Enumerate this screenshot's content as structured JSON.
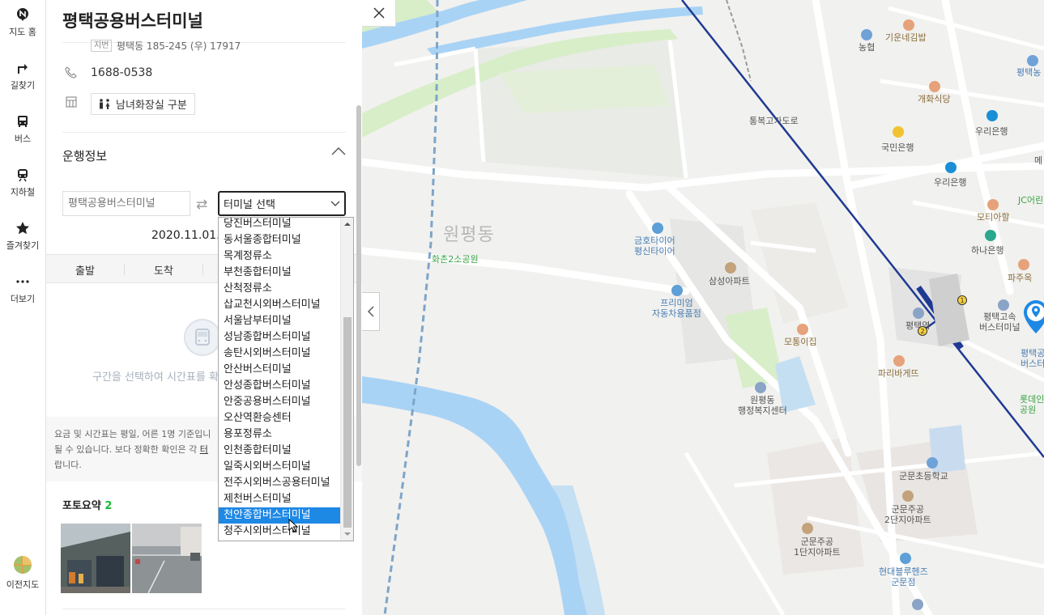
{
  "nav": {
    "items": [
      {
        "label": "지도 홈",
        "icon": "map-home-icon"
      },
      {
        "label": "길찾기",
        "icon": "directions-icon"
      },
      {
        "label": "버스",
        "icon": "bus-icon"
      },
      {
        "label": "지하철",
        "icon": "subway-icon"
      },
      {
        "label": "즐겨찾기",
        "icon": "star-icon"
      },
      {
        "label": "더보기",
        "icon": "more-icon"
      }
    ],
    "prev_map_label": "이전지도"
  },
  "panel": {
    "title": "평택공용버스터미널",
    "address_tag": "지번",
    "address": "평택동 185-245 (우) 17917",
    "phone": "1688-0538",
    "facility": "남녀화장실 구분",
    "section_title": "운행정보",
    "from_placeholder": "평택공용버스터미널",
    "select_label": "터미널 선택",
    "date": "2020.11.01.(",
    "tabs": [
      "출발",
      "도착"
    ],
    "hint": "구간을 선택하여 시간표를 확",
    "notice": {
      "line1": "요금 및 시간표는 평일, 어른 1명 기준입니",
      "line2_pre": "될 수 있습니다. 보다 정확한 확인은 각 ",
      "line2_link": "터",
      "line3": "랍니다."
    },
    "photo_title": "포토요약",
    "photo_count": "2"
  },
  "dropdown": {
    "options": [
      "당진버스터미널",
      "동서울종합터미널",
      "목계정류소",
      "부천종합터미널",
      "산척정류소",
      "삽교천시외버스터미널",
      "서울남부터미널",
      "성남종합버스터미널",
      "송탄시외버스터미널",
      "안산버스터미널",
      "안성종합버스터미널",
      "안중공용버스터미널",
      "오산역환승센터",
      "용포정류소",
      "인천종합터미널",
      "일죽시외버스터미널",
      "전주시외버스공용터미널",
      "제천버스터미널",
      "천안종합버스터미널",
      "청주시외버스터미널"
    ],
    "selected": "천안종합버스터미널"
  },
  "map": {
    "labels": {
      "wonpyeong": "원평동",
      "park": "화촌2소공원",
      "tire1": "금호타이어",
      "tire2": "평신타이어",
      "premium1": "프리미엄",
      "premium2": "자동차용품점",
      "samsung_apt": "삼성아파트",
      "motong": "모통이집",
      "paris": "파리바게뜨",
      "welfare1": "원평동",
      "welfare2": "행정복지센터",
      "school": "군문초등학교",
      "gunmun_apt2_1": "군문주공",
      "gunmun_apt2_2": "2단지아파트",
      "gunmun_apt1_1": "군문주공",
      "gunmun_apt1_2": "1단지아파트",
      "hyundai1": "현대블루헨즈",
      "hyundai2": "군문점",
      "station": "평택역",
      "express1": "평택고속",
      "express2": "버스터미널",
      "terminal1": "평택공",
      "terminal2": "버스터",
      "lotte1": "롯데인",
      "lotte2": "공원",
      "paju": "파주옥",
      "hana": "하나은행",
      "motira": "모티아할",
      "jc": "JC어린",
      "woori1": "우리은행",
      "woori2": "우리은행",
      "kookmin": "국민은행",
      "overpass": "통복고가도로",
      "gaehwa": "개화식당",
      "nonghyup": "농협",
      "nonghyup2": "평택농",
      "gium": "기운네김밥",
      "me": "메"
    },
    "station_badges": [
      "1",
      "2"
    ]
  },
  "colors": {
    "accent": "#1e88e5",
    "naver_green": "#19b832",
    "subway_line": "#1f3a93",
    "water": "#a9d3f5",
    "park": "#d8eec9"
  }
}
